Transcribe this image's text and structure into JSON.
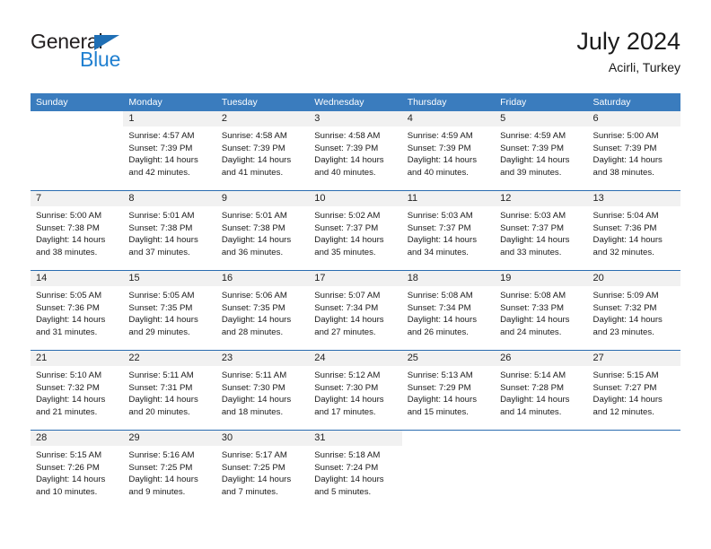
{
  "brand": {
    "word_one": "General",
    "word_two": "Blue",
    "flag_icon": "blue-triangle-flag",
    "accent_color": "#1f7fd0"
  },
  "header": {
    "title": "July 2024",
    "subtitle": "Acirli, Turkey"
  },
  "calendar": {
    "header_bg": "#3a7cbe",
    "row_divider_color": "#2a6cb0",
    "daynum_bg": "#f1f1f1",
    "day_headers": [
      "Sunday",
      "Monday",
      "Tuesday",
      "Wednesday",
      "Thursday",
      "Friday",
      "Saturday"
    ],
    "weeks": [
      [
        {
          "day": "",
          "lines": []
        },
        {
          "day": "1",
          "lines": [
            "Sunrise: 4:57 AM",
            "Sunset: 7:39 PM",
            "Daylight: 14 hours",
            "and 42 minutes."
          ]
        },
        {
          "day": "2",
          "lines": [
            "Sunrise: 4:58 AM",
            "Sunset: 7:39 PM",
            "Daylight: 14 hours",
            "and 41 minutes."
          ]
        },
        {
          "day": "3",
          "lines": [
            "Sunrise: 4:58 AM",
            "Sunset: 7:39 PM",
            "Daylight: 14 hours",
            "and 40 minutes."
          ]
        },
        {
          "day": "4",
          "lines": [
            "Sunrise: 4:59 AM",
            "Sunset: 7:39 PM",
            "Daylight: 14 hours",
            "and 40 minutes."
          ]
        },
        {
          "day": "5",
          "lines": [
            "Sunrise: 4:59 AM",
            "Sunset: 7:39 PM",
            "Daylight: 14 hours",
            "and 39 minutes."
          ]
        },
        {
          "day": "6",
          "lines": [
            "Sunrise: 5:00 AM",
            "Sunset: 7:39 PM",
            "Daylight: 14 hours",
            "and 38 minutes."
          ]
        }
      ],
      [
        {
          "day": "7",
          "lines": [
            "Sunrise: 5:00 AM",
            "Sunset: 7:38 PM",
            "Daylight: 14 hours",
            "and 38 minutes."
          ]
        },
        {
          "day": "8",
          "lines": [
            "Sunrise: 5:01 AM",
            "Sunset: 7:38 PM",
            "Daylight: 14 hours",
            "and 37 minutes."
          ]
        },
        {
          "day": "9",
          "lines": [
            "Sunrise: 5:01 AM",
            "Sunset: 7:38 PM",
            "Daylight: 14 hours",
            "and 36 minutes."
          ]
        },
        {
          "day": "10",
          "lines": [
            "Sunrise: 5:02 AM",
            "Sunset: 7:37 PM",
            "Daylight: 14 hours",
            "and 35 minutes."
          ]
        },
        {
          "day": "11",
          "lines": [
            "Sunrise: 5:03 AM",
            "Sunset: 7:37 PM",
            "Daylight: 14 hours",
            "and 34 minutes."
          ]
        },
        {
          "day": "12",
          "lines": [
            "Sunrise: 5:03 AM",
            "Sunset: 7:37 PM",
            "Daylight: 14 hours",
            "and 33 minutes."
          ]
        },
        {
          "day": "13",
          "lines": [
            "Sunrise: 5:04 AM",
            "Sunset: 7:36 PM",
            "Daylight: 14 hours",
            "and 32 minutes."
          ]
        }
      ],
      [
        {
          "day": "14",
          "lines": [
            "Sunrise: 5:05 AM",
            "Sunset: 7:36 PM",
            "Daylight: 14 hours",
            "and 31 minutes."
          ]
        },
        {
          "day": "15",
          "lines": [
            "Sunrise: 5:05 AM",
            "Sunset: 7:35 PM",
            "Daylight: 14 hours",
            "and 29 minutes."
          ]
        },
        {
          "day": "16",
          "lines": [
            "Sunrise: 5:06 AM",
            "Sunset: 7:35 PM",
            "Daylight: 14 hours",
            "and 28 minutes."
          ]
        },
        {
          "day": "17",
          "lines": [
            "Sunrise: 5:07 AM",
            "Sunset: 7:34 PM",
            "Daylight: 14 hours",
            "and 27 minutes."
          ]
        },
        {
          "day": "18",
          "lines": [
            "Sunrise: 5:08 AM",
            "Sunset: 7:34 PM",
            "Daylight: 14 hours",
            "and 26 minutes."
          ]
        },
        {
          "day": "19",
          "lines": [
            "Sunrise: 5:08 AM",
            "Sunset: 7:33 PM",
            "Daylight: 14 hours",
            "and 24 minutes."
          ]
        },
        {
          "day": "20",
          "lines": [
            "Sunrise: 5:09 AM",
            "Sunset: 7:32 PM",
            "Daylight: 14 hours",
            "and 23 minutes."
          ]
        }
      ],
      [
        {
          "day": "21",
          "lines": [
            "Sunrise: 5:10 AM",
            "Sunset: 7:32 PM",
            "Daylight: 14 hours",
            "and 21 minutes."
          ]
        },
        {
          "day": "22",
          "lines": [
            "Sunrise: 5:11 AM",
            "Sunset: 7:31 PM",
            "Daylight: 14 hours",
            "and 20 minutes."
          ]
        },
        {
          "day": "23",
          "lines": [
            "Sunrise: 5:11 AM",
            "Sunset: 7:30 PM",
            "Daylight: 14 hours",
            "and 18 minutes."
          ]
        },
        {
          "day": "24",
          "lines": [
            "Sunrise: 5:12 AM",
            "Sunset: 7:30 PM",
            "Daylight: 14 hours",
            "and 17 minutes."
          ]
        },
        {
          "day": "25",
          "lines": [
            "Sunrise: 5:13 AM",
            "Sunset: 7:29 PM",
            "Daylight: 14 hours",
            "and 15 minutes."
          ]
        },
        {
          "day": "26",
          "lines": [
            "Sunrise: 5:14 AM",
            "Sunset: 7:28 PM",
            "Daylight: 14 hours",
            "and 14 minutes."
          ]
        },
        {
          "day": "27",
          "lines": [
            "Sunrise: 5:15 AM",
            "Sunset: 7:27 PM",
            "Daylight: 14 hours",
            "and 12 minutes."
          ]
        }
      ],
      [
        {
          "day": "28",
          "lines": [
            "Sunrise: 5:15 AM",
            "Sunset: 7:26 PM",
            "Daylight: 14 hours",
            "and 10 minutes."
          ]
        },
        {
          "day": "29",
          "lines": [
            "Sunrise: 5:16 AM",
            "Sunset: 7:25 PM",
            "Daylight: 14 hours",
            "and 9 minutes."
          ]
        },
        {
          "day": "30",
          "lines": [
            "Sunrise: 5:17 AM",
            "Sunset: 7:25 PM",
            "Daylight: 14 hours",
            "and 7 minutes."
          ]
        },
        {
          "day": "31",
          "lines": [
            "Sunrise: 5:18 AM",
            "Sunset: 7:24 PM",
            "Daylight: 14 hours",
            "and 5 minutes."
          ]
        },
        {
          "day": "",
          "lines": []
        },
        {
          "day": "",
          "lines": []
        },
        {
          "day": "",
          "lines": []
        }
      ]
    ]
  }
}
